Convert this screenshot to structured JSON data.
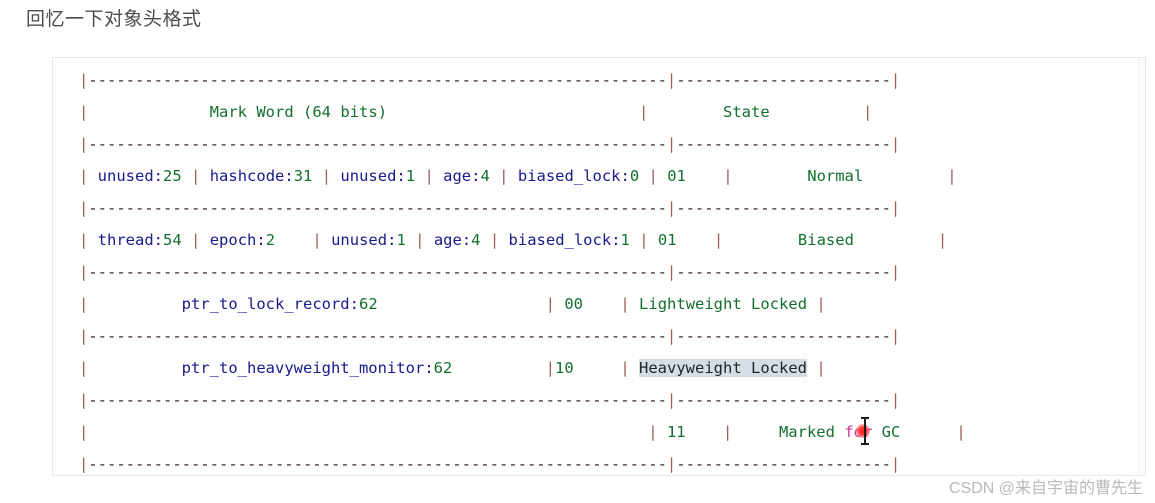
{
  "page": {
    "heading": "回忆一下对象头格式",
    "watermark": "CSDN @来自宇宙的曹先生",
    "background_color": "#ffffff"
  },
  "colors": {
    "pipe": "#9d5b5b",
    "dash": "#3b1f28",
    "identifier": "#1a1a8c",
    "number": "#14702f",
    "word": "#14702f",
    "keyword": "#c9379d",
    "selection_background": "#d5dee6",
    "selection_text": "#20242a",
    "block_border": "#e8e8e8",
    "block_background": "#fefefe",
    "cursor": "#ff1f1f"
  },
  "code_block": {
    "separator_run_left": "--------------------------------------------------------------",
    "separator_run_right": "-----------------------",
    "selection": "Heavyweight Locked",
    "cursor_present": true,
    "table": {
      "header": {
        "mark_word": "Mark Word (64 bits)",
        "state": "State"
      },
      "rows": [
        {
          "fields": [
            "unused:25",
            "hashcode:31",
            "unused:1",
            "age:4",
            "biased_lock:0"
          ],
          "tag_bits": "01",
          "state": "Normal"
        },
        {
          "fields": [
            "thread:54",
            "epoch:2",
            "unused:1",
            "age:4",
            "biased_lock:1"
          ],
          "tag_bits": "01",
          "state": "Biased"
        },
        {
          "fields": [
            "ptr_to_lock_record:62"
          ],
          "tag_bits": "00",
          "state": "Lightweight Locked"
        },
        {
          "fields": [
            "ptr_to_heavyweight_monitor:62"
          ],
          "tag_bits": "10",
          "state": "Heavyweight Locked"
        },
        {
          "fields": [],
          "tag_bits": "11",
          "state": "Marked for GC"
        }
      ]
    },
    "lines": [
      {
        "id": "sep-0",
        "kind": "separator",
        "segments": [
          {
            "text": "|",
            "cls": "t-pipe"
          },
          {
            "text": "--------------------------------------------------------------",
            "cls": "t-dash"
          },
          {
            "text": "|",
            "cls": "t-pipe"
          },
          {
            "text": "-----------------------",
            "cls": "t-dash"
          },
          {
            "text": "|",
            "cls": "t-pipe"
          }
        ]
      },
      {
        "id": "row-header",
        "kind": "content",
        "segments": [
          {
            "text": "|",
            "cls": "t-pipe"
          },
          {
            "text": "             ",
            "cls": "t-plain"
          },
          {
            "text": "Mark",
            "cls": "t-word"
          },
          {
            "text": " ",
            "cls": "t-plain"
          },
          {
            "text": "Word",
            "cls": "t-word"
          },
          {
            "text": " (",
            "cls": "t-word"
          },
          {
            "text": "64",
            "cls": "t-num"
          },
          {
            "text": " ",
            "cls": "t-plain"
          },
          {
            "text": "bits",
            "cls": "t-word"
          },
          {
            "text": ")",
            "cls": "t-word"
          },
          {
            "text": "                           ",
            "cls": "t-plain"
          },
          {
            "text": "|",
            "cls": "t-pipe"
          },
          {
            "text": "        ",
            "cls": "t-plain"
          },
          {
            "text": "State",
            "cls": "t-word"
          },
          {
            "text": "          ",
            "cls": "t-plain"
          },
          {
            "text": "|",
            "cls": "t-pipe"
          }
        ]
      },
      {
        "id": "sep-1",
        "kind": "separator",
        "segments": [
          {
            "text": "|",
            "cls": "t-pipe"
          },
          {
            "text": "--------------------------------------------------------------",
            "cls": "t-dash"
          },
          {
            "text": "|",
            "cls": "t-pipe"
          },
          {
            "text": "-----------------------",
            "cls": "t-dash"
          },
          {
            "text": "|",
            "cls": "t-pipe"
          }
        ]
      },
      {
        "id": "row-normal",
        "kind": "content",
        "segments": [
          {
            "text": "| ",
            "cls": "t-pipe"
          },
          {
            "text": "unused",
            "cls": "t-ident"
          },
          {
            "text": ":",
            "cls": "t-colon"
          },
          {
            "text": "25",
            "cls": "t-num"
          },
          {
            "text": " ",
            "cls": "t-plain"
          },
          {
            "text": "|",
            "cls": "t-pipe"
          },
          {
            "text": " ",
            "cls": "t-plain"
          },
          {
            "text": "hashcode",
            "cls": "t-ident"
          },
          {
            "text": ":",
            "cls": "t-colon"
          },
          {
            "text": "31",
            "cls": "t-num"
          },
          {
            "text": " ",
            "cls": "t-plain"
          },
          {
            "text": "|",
            "cls": "t-pipe"
          },
          {
            "text": " ",
            "cls": "t-plain"
          },
          {
            "text": "unused",
            "cls": "t-ident"
          },
          {
            "text": ":",
            "cls": "t-colon"
          },
          {
            "text": "1",
            "cls": "t-num"
          },
          {
            "text": " ",
            "cls": "t-plain"
          },
          {
            "text": "|",
            "cls": "t-pipe"
          },
          {
            "text": " ",
            "cls": "t-plain"
          },
          {
            "text": "age",
            "cls": "t-ident"
          },
          {
            "text": ":",
            "cls": "t-colon"
          },
          {
            "text": "4",
            "cls": "t-num"
          },
          {
            "text": " ",
            "cls": "t-plain"
          },
          {
            "text": "|",
            "cls": "t-pipe"
          },
          {
            "text": " ",
            "cls": "t-plain"
          },
          {
            "text": "biased_lock",
            "cls": "t-ident"
          },
          {
            "text": ":",
            "cls": "t-colon"
          },
          {
            "text": "0",
            "cls": "t-num"
          },
          {
            "text": " ",
            "cls": "t-plain"
          },
          {
            "text": "|",
            "cls": "t-pipe"
          },
          {
            "text": " ",
            "cls": "t-plain"
          },
          {
            "text": "01",
            "cls": "t-num"
          },
          {
            "text": "    ",
            "cls": "t-plain"
          },
          {
            "text": "|",
            "cls": "t-pipe"
          },
          {
            "text": "        ",
            "cls": "t-plain"
          },
          {
            "text": "Normal",
            "cls": "t-word"
          },
          {
            "text": "         ",
            "cls": "t-plain"
          },
          {
            "text": "|",
            "cls": "t-pipe"
          }
        ]
      },
      {
        "id": "sep-2",
        "kind": "separator",
        "segments": [
          {
            "text": "|",
            "cls": "t-pipe"
          },
          {
            "text": "--------------------------------------------------------------",
            "cls": "t-dash"
          },
          {
            "text": "|",
            "cls": "t-pipe"
          },
          {
            "text": "-----------------------",
            "cls": "t-dash"
          },
          {
            "text": "|",
            "cls": "t-pipe"
          }
        ]
      },
      {
        "id": "row-biased",
        "kind": "content",
        "segments": [
          {
            "text": "| ",
            "cls": "t-pipe"
          },
          {
            "text": "thread",
            "cls": "t-ident"
          },
          {
            "text": ":",
            "cls": "t-colon"
          },
          {
            "text": "54",
            "cls": "t-num"
          },
          {
            "text": " ",
            "cls": "t-plain"
          },
          {
            "text": "|",
            "cls": "t-pipe"
          },
          {
            "text": " ",
            "cls": "t-plain"
          },
          {
            "text": "epoch",
            "cls": "t-ident"
          },
          {
            "text": ":",
            "cls": "t-colon"
          },
          {
            "text": "2",
            "cls": "t-num"
          },
          {
            "text": "    ",
            "cls": "t-plain"
          },
          {
            "text": "|",
            "cls": "t-pipe"
          },
          {
            "text": " ",
            "cls": "t-plain"
          },
          {
            "text": "unused",
            "cls": "t-ident"
          },
          {
            "text": ":",
            "cls": "t-colon"
          },
          {
            "text": "1",
            "cls": "t-num"
          },
          {
            "text": " ",
            "cls": "t-plain"
          },
          {
            "text": "|",
            "cls": "t-pipe"
          },
          {
            "text": " ",
            "cls": "t-plain"
          },
          {
            "text": "age",
            "cls": "t-ident"
          },
          {
            "text": ":",
            "cls": "t-colon"
          },
          {
            "text": "4",
            "cls": "t-num"
          },
          {
            "text": " ",
            "cls": "t-plain"
          },
          {
            "text": "|",
            "cls": "t-pipe"
          },
          {
            "text": " ",
            "cls": "t-plain"
          },
          {
            "text": "biased_lock",
            "cls": "t-ident"
          },
          {
            "text": ":",
            "cls": "t-colon"
          },
          {
            "text": "1",
            "cls": "t-num"
          },
          {
            "text": " ",
            "cls": "t-plain"
          },
          {
            "text": "|",
            "cls": "t-pipe"
          },
          {
            "text": " ",
            "cls": "t-plain"
          },
          {
            "text": "01",
            "cls": "t-num"
          },
          {
            "text": "    ",
            "cls": "t-plain"
          },
          {
            "text": "|",
            "cls": "t-pipe"
          },
          {
            "text": "        ",
            "cls": "t-plain"
          },
          {
            "text": "Biased",
            "cls": "t-word"
          },
          {
            "text": "         ",
            "cls": "t-plain"
          },
          {
            "text": "|",
            "cls": "t-pipe"
          }
        ]
      },
      {
        "id": "sep-3",
        "kind": "separator",
        "segments": [
          {
            "text": "|",
            "cls": "t-pipe"
          },
          {
            "text": "--------------------------------------------------------------",
            "cls": "t-dash"
          },
          {
            "text": "|",
            "cls": "t-pipe"
          },
          {
            "text": "-----------------------",
            "cls": "t-dash"
          },
          {
            "text": "|",
            "cls": "t-pipe"
          }
        ]
      },
      {
        "id": "row-lightweight",
        "kind": "content",
        "segments": [
          {
            "text": "|",
            "cls": "t-pipe"
          },
          {
            "text": "          ",
            "cls": "t-plain"
          },
          {
            "text": "ptr_to_lock_record",
            "cls": "t-ident"
          },
          {
            "text": ":",
            "cls": "t-colon"
          },
          {
            "text": "62",
            "cls": "t-num"
          },
          {
            "text": "                  ",
            "cls": "t-plain"
          },
          {
            "text": "|",
            "cls": "t-pipe"
          },
          {
            "text": " ",
            "cls": "t-plain"
          },
          {
            "text": "00",
            "cls": "t-num"
          },
          {
            "text": "    ",
            "cls": "t-plain"
          },
          {
            "text": "|",
            "cls": "t-pipe"
          },
          {
            "text": " ",
            "cls": "t-plain"
          },
          {
            "text": "Lightweight",
            "cls": "t-word"
          },
          {
            "text": " ",
            "cls": "t-plain"
          },
          {
            "text": "Locked",
            "cls": "t-word"
          },
          {
            "text": " ",
            "cls": "t-plain"
          },
          {
            "text": "|",
            "cls": "t-pipe"
          }
        ]
      },
      {
        "id": "sep-4",
        "kind": "separator",
        "segments": [
          {
            "text": "|",
            "cls": "t-pipe"
          },
          {
            "text": "--------------------------------------------------------------",
            "cls": "t-dash"
          },
          {
            "text": "|",
            "cls": "t-pipe"
          },
          {
            "text": "-----------------------",
            "cls": "t-dash"
          },
          {
            "text": "|",
            "cls": "t-pipe"
          }
        ]
      },
      {
        "id": "row-heavyweight",
        "kind": "content",
        "segments": [
          {
            "text": "|",
            "cls": "t-pipe"
          },
          {
            "text": "          ",
            "cls": "t-plain"
          },
          {
            "text": "ptr_to_heavyweight_monitor",
            "cls": "t-ident"
          },
          {
            "text": ":",
            "cls": "t-colon"
          },
          {
            "text": "62",
            "cls": "t-num"
          },
          {
            "text": "          ",
            "cls": "t-plain"
          },
          {
            "text": "|",
            "cls": "t-pipe"
          },
          {
            "text": "10",
            "cls": "t-num"
          },
          {
            "text": "    ",
            "cls": "t-plain"
          },
          {
            "text": " |",
            "cls": "t-pipe"
          },
          {
            "text": " ",
            "cls": "t-plain"
          },
          {
            "text": "Heavyweight Locked",
            "cls": "t-sel"
          },
          {
            "text": " ",
            "cls": "t-plain"
          },
          {
            "text": "|",
            "cls": "t-pipe"
          }
        ]
      },
      {
        "id": "sep-5",
        "kind": "separator",
        "segments": [
          {
            "text": "|",
            "cls": "t-pipe"
          },
          {
            "text": "--------------------------------------------------------------",
            "cls": "t-dash"
          },
          {
            "text": "|",
            "cls": "t-pipe"
          },
          {
            "text": "-----------------------",
            "cls": "t-dash"
          },
          {
            "text": "|",
            "cls": "t-pipe"
          }
        ]
      },
      {
        "id": "row-gc",
        "kind": "content",
        "segments": [
          {
            "text": "|",
            "cls": "t-pipe"
          },
          {
            "text": "                                                            ",
            "cls": "t-plain"
          },
          {
            "text": "|",
            "cls": "t-pipe"
          },
          {
            "text": " ",
            "cls": "t-plain"
          },
          {
            "text": "11",
            "cls": "t-num"
          },
          {
            "text": "    ",
            "cls": "t-plain"
          },
          {
            "text": "|",
            "cls": "t-pipe"
          },
          {
            "text": "     ",
            "cls": "t-plain"
          },
          {
            "text": "Marked",
            "cls": "t-word"
          },
          {
            "text": " ",
            "cls": "t-plain"
          },
          {
            "text": "for",
            "cls": "t-kw"
          },
          {
            "text": " ",
            "cls": "t-plain"
          },
          {
            "text": "GC",
            "cls": "t-word"
          },
          {
            "text": "      ",
            "cls": "t-plain"
          },
          {
            "text": "|",
            "cls": "t-pipe"
          }
        ]
      },
      {
        "id": "sep-6",
        "kind": "separator",
        "segments": [
          {
            "text": "|",
            "cls": "t-pipe"
          },
          {
            "text": "--------------------------------------------------------------",
            "cls": "t-dash"
          },
          {
            "text": "|",
            "cls": "t-pipe"
          },
          {
            "text": "-----------------------",
            "cls": "t-dash"
          },
          {
            "text": "|",
            "cls": "t-pipe"
          }
        ]
      }
    ]
  }
}
